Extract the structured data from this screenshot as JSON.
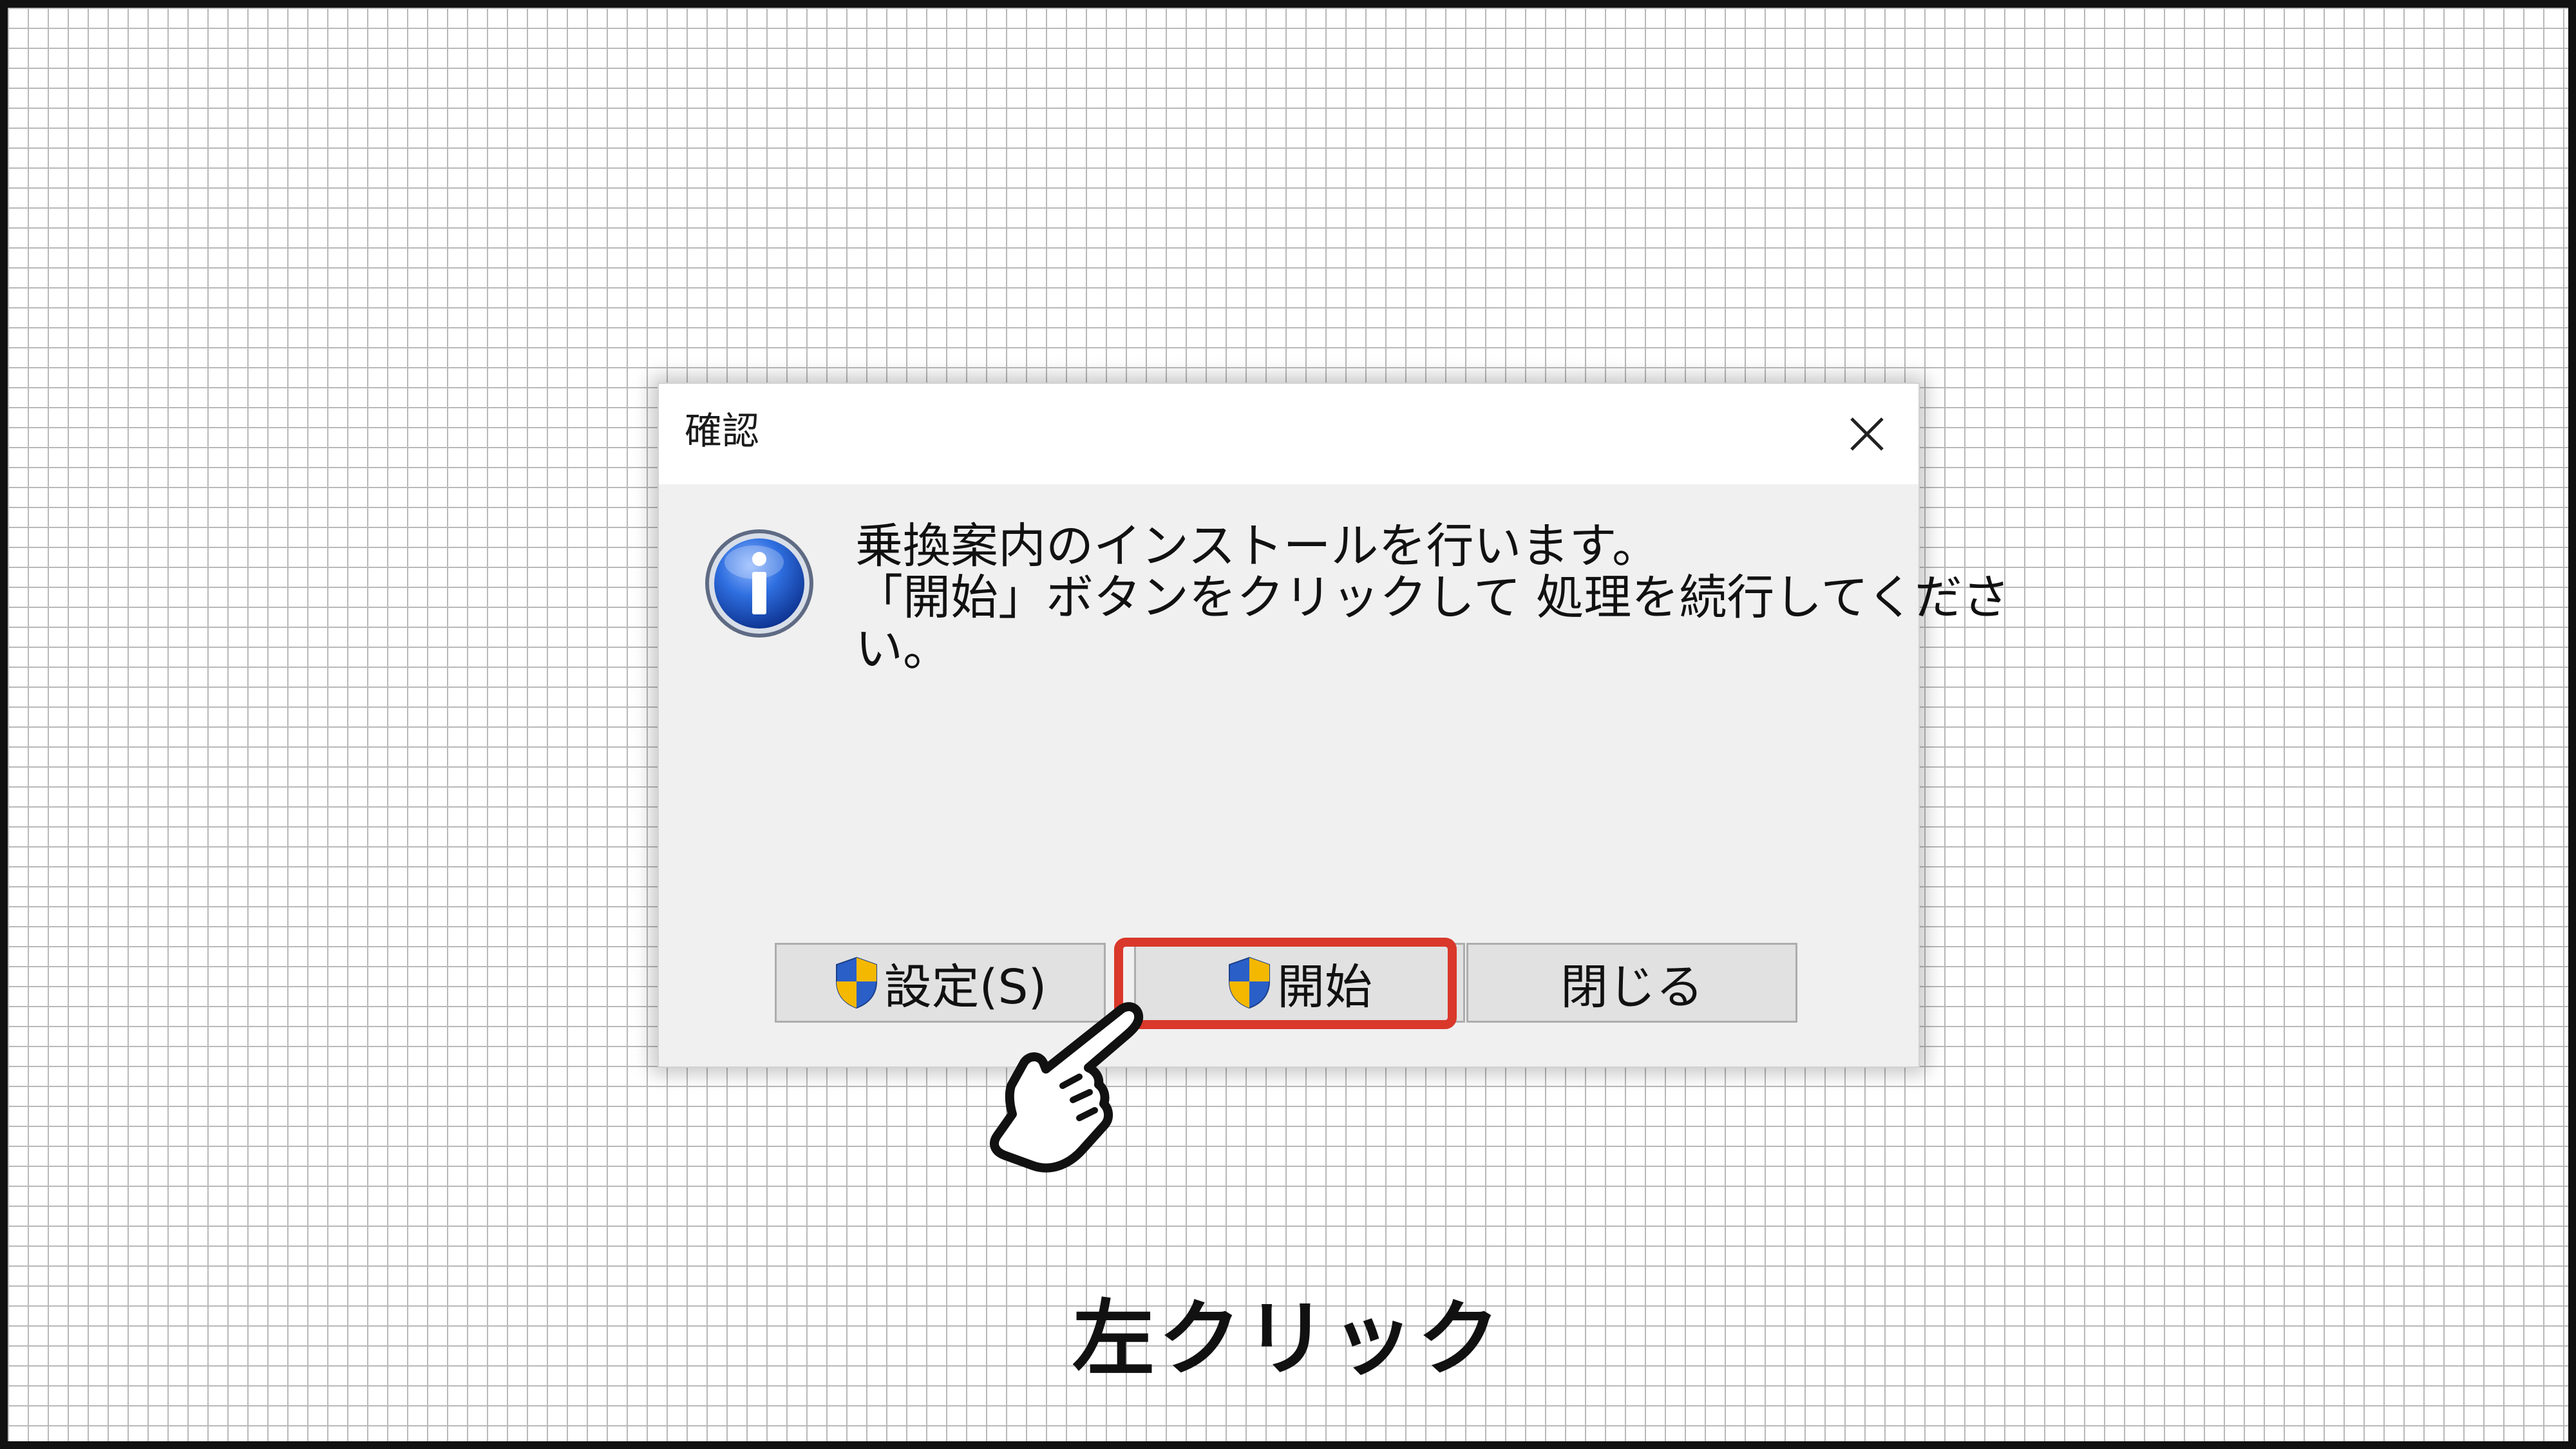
{
  "dialog": {
    "title": "確認",
    "close_icon": "close-icon",
    "info_icon": "info-icon",
    "message_lines": [
      "乗換案内のインストールを行います。",
      "「開始」ボタンをクリックして 処理を続行してくださ",
      "い。"
    ],
    "buttons": {
      "settings_label": "設定(S)",
      "start_label": "開始",
      "close_label": "閉じる"
    },
    "shield_icon": "uac-shield-icon"
  },
  "annotation": {
    "caption": "左クリック",
    "highlight_color": "#d9382a",
    "pointer_icon": "pointing-hand-icon"
  }
}
